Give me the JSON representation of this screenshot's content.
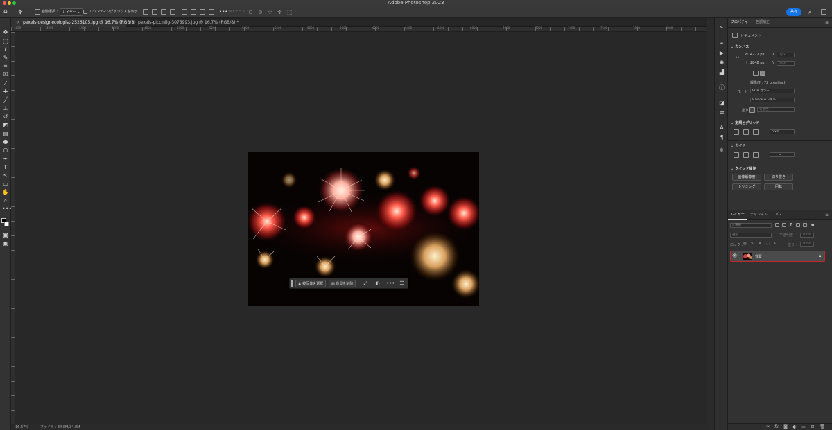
{
  "window": {
    "title": "Adobe Photoshop 2023"
  },
  "options_bar": {
    "auto_select_label": "自動選択 :",
    "auto_select_value": "レイヤー",
    "bbox_label": "バウンディングボックスを表示",
    "mode_3d_label": "3D モード :",
    "share_label": "共有"
  },
  "tabs": [
    {
      "label": "pexels-designecologist-2526105.jpg @ 16.7% (RGB/8)"
    },
    {
      "label": "pexels-picciniig-3075993.jpg @ 16.7% (RGB/8) *"
    }
  ],
  "ruler": {
    "ticks": [
      "4000",
      "4200",
      "4400",
      "4600",
      "4800",
      "5000",
      "5200",
      "5400",
      "5600",
      "5800",
      "6000",
      "6200",
      "6400",
      "6600",
      "6800",
      "7000",
      "7200",
      "7400",
      "7600",
      "7800",
      "8000"
    ]
  },
  "contextual_bar": {
    "select_subject": "被写体を選択",
    "remove_background": "背景を削除"
  },
  "status": {
    "zoom": "16.67%",
    "file_info": "ファイル : 34.8M/34.8M"
  },
  "panels": {
    "tab_properties": "プロパティ",
    "tab_color_adjust": "色調補正",
    "document_label": "ドキュメント",
    "canvas_title": "カンバス",
    "w_label": "W",
    "w_value": "4272 px",
    "h_label": "H",
    "h_value": "2848 px",
    "x_label": "X",
    "x_value": "0 px",
    "y_label": "Y",
    "y_value": "0 px",
    "resolution": "解像度 : 72 pixel/inch",
    "mode_label": "モード",
    "mode_value": "RGB カラー",
    "bits_value": "8 bit/チャンネル",
    "fill_label": "塗り",
    "fill_value": "背景色",
    "rulers_grid_title": "定規とグリッド",
    "unit_value": "pixel",
    "guides_title": "ガイド",
    "quick_actions_title": "クイック操作",
    "qa_image_trim": "画像解像度",
    "qa_crop": "切り抜き",
    "qa_trim": "トリミング",
    "qa_rotate": "回転"
  },
  "layers": {
    "tab_layers": "レイヤー",
    "tab_channels": "チャンネル",
    "tab_paths": "パス",
    "filter_placeholder": "種類",
    "blend_mode": "通常",
    "opacity_label": "不透明度 :",
    "opacity_value": "100%",
    "lock_label": "ロック :",
    "fill_label": "塗り :",
    "fill_value": "100%",
    "items": [
      {
        "name": "背景"
      }
    ]
  },
  "colors": {
    "accent": "#1473e6",
    "selection_outline": "#c0282d"
  }
}
